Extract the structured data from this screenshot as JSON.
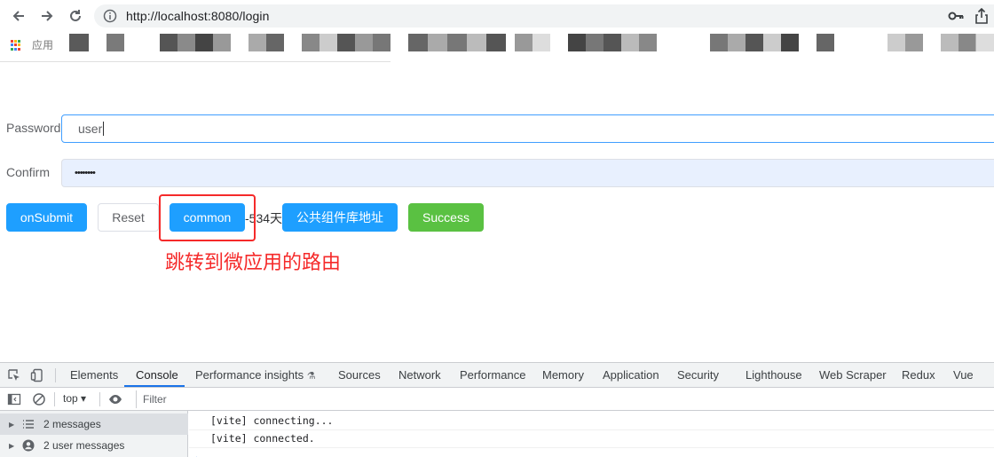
{
  "browser": {
    "url": "http://localhost:8080/login",
    "bookmarks_label": "应用"
  },
  "form": {
    "password_label": "Password",
    "password_value": "user",
    "confirm_label": "Confirm",
    "confirm_value": "••••••••"
  },
  "buttons": {
    "submit": "onSubmit",
    "reset": "Reset",
    "common": "common",
    "days_text": "-534天",
    "component_lib": "公共组件库地址",
    "success": "Success"
  },
  "annotation": {
    "text": "跳转到微应用的路由",
    "color": "#f52a2a"
  },
  "colors": {
    "primary": "#1e9fff",
    "success": "#5ac142",
    "focus_border": "#409eff",
    "autofill_bg": "#e8f0fe"
  },
  "devtools": {
    "tabs": [
      "Elements",
      "Console",
      "Performance insights",
      "Sources",
      "Network",
      "Performance",
      "Memory",
      "Application",
      "Security",
      "Lighthouse",
      "Web Scraper",
      "Redux",
      "Vue"
    ],
    "active_tab": "Console",
    "context": "top ▾",
    "filter_placeholder": "Filter",
    "sidebar": [
      {
        "label": "2 messages",
        "icon": "list-icon"
      },
      {
        "label": "2 user messages",
        "icon": "user-icon"
      }
    ],
    "logs": [
      "[vite] connecting...",
      "[vite] connected."
    ],
    "prompt": "›"
  }
}
